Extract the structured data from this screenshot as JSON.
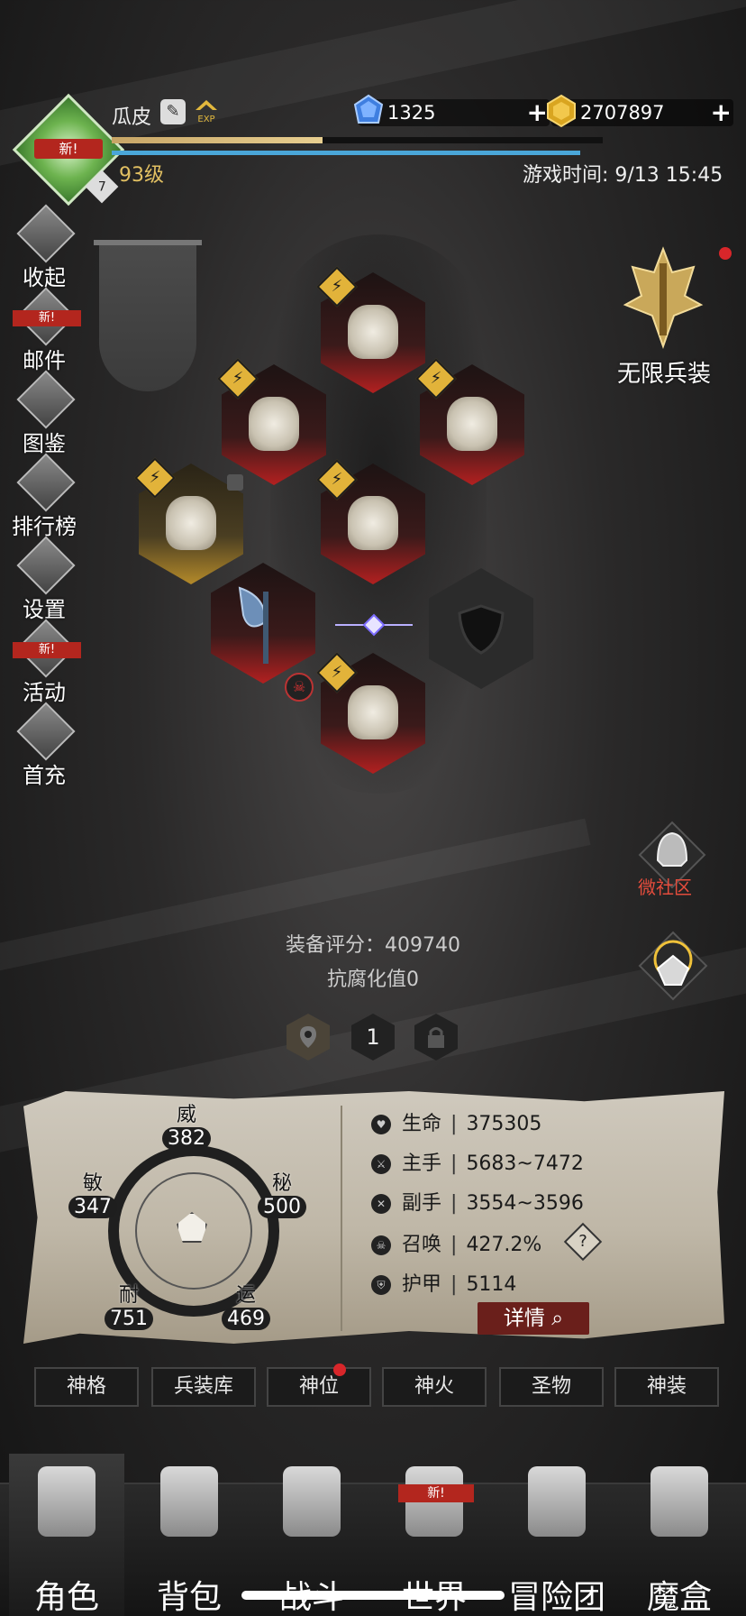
{
  "header": {
    "username": "瓜皮",
    "level": "93级",
    "avatar_level": "7",
    "avatar_new": "新!",
    "exp_label": "EXP",
    "exp_progress": 0.43,
    "game_time": "游戏时间: 9/13 15:45",
    "gems": "1325",
    "gold": "2707897"
  },
  "side_menu": [
    {
      "label": "收起",
      "icon": "collapse-icon"
    },
    {
      "label": "邮件",
      "icon": "mail-icon",
      "badge": "新!"
    },
    {
      "label": "图鉴",
      "icon": "book-icon"
    },
    {
      "label": "排行榜",
      "icon": "ranking-icon"
    },
    {
      "label": "设置",
      "icon": "gear-icon"
    },
    {
      "label": "活动",
      "icon": "event-icon",
      "badge": "新!"
    },
    {
      "label": "首充",
      "icon": "first-charge-icon"
    }
  ],
  "right_panel": {
    "infinite_label": "无限兵装",
    "community_label": "微社区"
  },
  "equipment": {
    "score_text": "装备评分：409740",
    "corruption_text": "抗腐化值0",
    "slot_buttons": [
      "",
      "1",
      ""
    ]
  },
  "stats": {
    "attributes": {
      "wei": {
        "label": "威",
        "value": "382"
      },
      "mi": {
        "label": "秘",
        "value": "500"
      },
      "min": {
        "label": "敏",
        "value": "347"
      },
      "nai": {
        "label": "耐",
        "value": "751"
      },
      "yun": {
        "label": "运",
        "value": "469"
      }
    },
    "rows": [
      {
        "label": "生命",
        "value": "375305"
      },
      {
        "label": "主手",
        "value": "5683~7472"
      },
      {
        "label": "副手",
        "value": "3554~3596"
      },
      {
        "label": "召唤",
        "value": "427.2%"
      },
      {
        "label": "护甲",
        "value": "5114"
      }
    ],
    "details_label": "详情"
  },
  "tabs": [
    "神格",
    "兵装库",
    "神位",
    "神火",
    "圣物",
    "神装"
  ],
  "bottom_nav": [
    {
      "label": "角色",
      "icon": "helmet-icon"
    },
    {
      "label": "背包",
      "icon": "backpack-icon"
    },
    {
      "label": "战斗",
      "icon": "sword-shield-icon"
    },
    {
      "label": "世界",
      "icon": "world-map-icon",
      "badge": "新!"
    },
    {
      "label": "冒险团",
      "icon": "castle-icon"
    },
    {
      "label": "魔盒",
      "icon": "magic-box-icon"
    }
  ],
  "colors": {
    "accent_gold": "#e2c062",
    "alert_red": "#d8262a",
    "exp_bar": "#c7a566",
    "mp_bar": "#4aa6d8"
  }
}
